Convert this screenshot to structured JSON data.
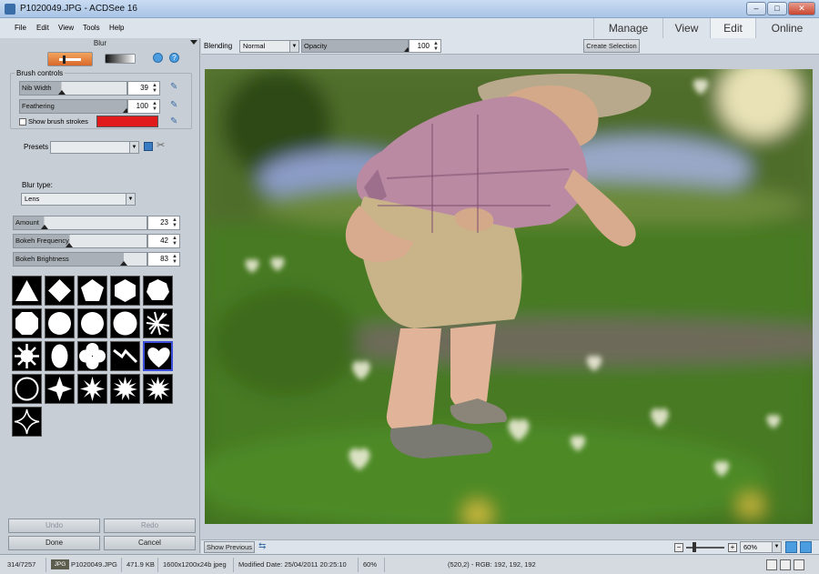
{
  "window": {
    "title": "P1020049.JPG - ACDSee 16",
    "min": "–",
    "max": "□",
    "close": "✕"
  },
  "menu": [
    "File",
    "Edit",
    "View",
    "Tools",
    "Help"
  ],
  "mode_tabs": [
    "Manage",
    "View",
    "Edit",
    "Online"
  ],
  "active_mode": "Edit",
  "panel": {
    "title": "Blur",
    "brush_controls_label": "Brush controls",
    "nib_width": {
      "label": "Nib Width",
      "value": "39",
      "level": 0.39
    },
    "feathering": {
      "label": "Feathering",
      "value": "100",
      "level": 1.0
    },
    "show_strokes_label": "Show brush strokes",
    "presets_label": "Presets",
    "blur_type_label": "Blur type:",
    "blur_type_value": "Lens",
    "amount": {
      "label": "Amount",
      "value": "23",
      "level": 0.23
    },
    "bokeh_frequency": {
      "label": "Bokeh Frequency",
      "value": "42",
      "level": 0.42
    },
    "bokeh_brightness": {
      "label": "Bokeh Brightness",
      "value": "83",
      "level": 0.83
    },
    "undo": "Undo",
    "redo": "Redo",
    "done": "Done",
    "cancel": "Cancel"
  },
  "toolbar": {
    "blending_label": "Blending",
    "blending_value": "Normal",
    "opacity_label": "Opacity",
    "opacity_value": "100",
    "opacity_level": 1.0,
    "create_selection": "Create Selection"
  },
  "bottom": {
    "show_previous": "Show Previous",
    "zoom": "60%"
  },
  "status": {
    "index": "314/7257",
    "format": "JPG",
    "filename": "P1020049.JPG",
    "size": "471.9 KB",
    "dimensions": "1600x1200x24b jpeg",
    "modified": "Modified Date: 25/04/2011 20:25:10",
    "zoom": "60%",
    "pixel": "(520,2) - RGB: 192, 192, 192"
  },
  "colors": {
    "brush_stroke": "#e11b1b",
    "selection_border": "#3b4fd8"
  }
}
